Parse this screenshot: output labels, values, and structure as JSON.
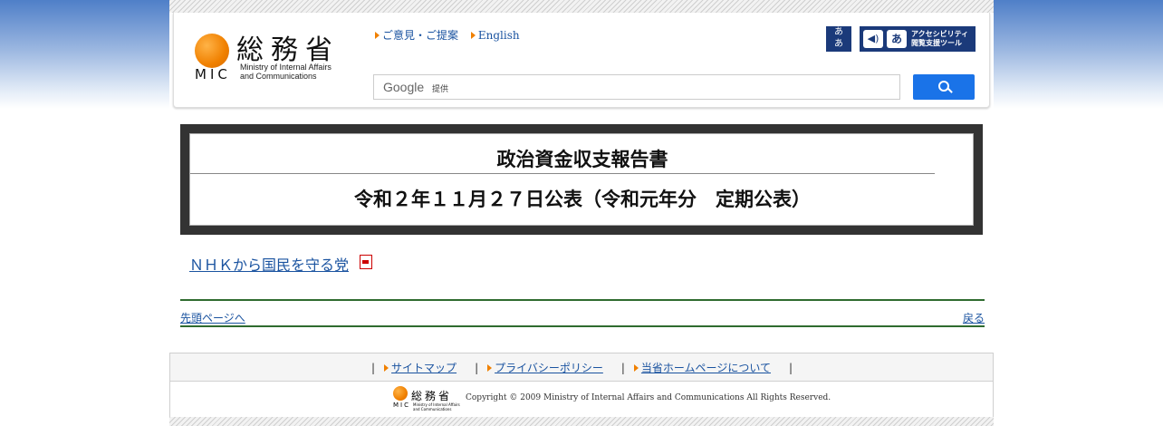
{
  "header": {
    "logo_kanji": "総務省",
    "logo_abbr": "MIC",
    "logo_sub1": "Ministry of Internal Affairs",
    "logo_sub2": "and Communications",
    "links": [
      "ご意見・ご提案",
      "English"
    ],
    "moji_button": "あ\nあ",
    "access_tool_line1": "アクセシビリティ",
    "access_tool_line2": "閲覧支援ツール",
    "search": {
      "brand": "Google",
      "provided": "提供",
      "placeholder": ""
    }
  },
  "title": {
    "line1": "政治資金収支報告書",
    "line2": "令和２年１１月２７日公表（令和元年分　定期公表）"
  },
  "content": {
    "link": "ＮＨＫから国民を守る党"
  },
  "nav": {
    "to_top": "先頭ページへ",
    "back": "戻る"
  },
  "footer": {
    "links": [
      "サイトマップ",
      "プライバシーポリシー",
      "当省ホームページについて"
    ],
    "logo_kanji": "総務省",
    "logo_abbr": "MIC",
    "logo_sub": "Ministry of Internal Affairs and Communications",
    "copyright": "Copyright © 2009 Ministry of Internal Affairs and Communications All Rights Reserved."
  },
  "colors": {
    "accent_orange": "#f08000",
    "link_blue": "#1a53a0",
    "rule_green": "#2f6b2f",
    "search_button": "#1a73e8"
  }
}
